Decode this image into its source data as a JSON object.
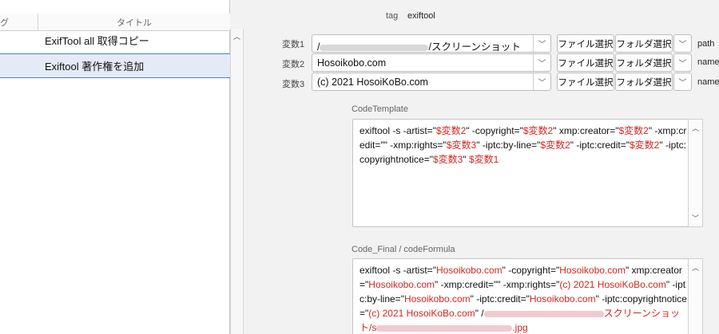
{
  "list": {
    "columns": {
      "tag": "グ",
      "title": "タイトル"
    },
    "rows": [
      {
        "title": "ExifTool all 取得コピー"
      },
      {
        "title": "Exiftool 著作権を追加"
      }
    ]
  },
  "detail": {
    "tag_label": "tag",
    "tag_value": "exiftool",
    "vars": [
      {
        "label": "変数1",
        "value_prefix": "/",
        "value_suffix": "/スクリーンショット",
        "right_label": "path"
      },
      {
        "label": "変数2",
        "value": "Hosoikobo.com",
        "right_label": "name"
      },
      {
        "label": "変数3",
        "value": "(c) 2021 HosoiKoBo.com",
        "right_label": "name"
      }
    ],
    "buttons": {
      "file_select": "ファイル選択",
      "folder_select": "フォルダ選択"
    },
    "code_template": {
      "title": "CodeTemplate",
      "segments": [
        {
          "t": "exiftool -s -artist=\""
        },
        {
          "t": "$変数2",
          "v": true
        },
        {
          "t": "\" -copyright=\""
        },
        {
          "t": "$変数2",
          "v": true
        },
        {
          "t": "\" xmp:creator=\""
        },
        {
          "t": "$変数2",
          "v": true
        },
        {
          "t": "\" -xmp:credit=\"\"  -xmp:rights=\""
        },
        {
          "t": "$変数3",
          "v": true
        },
        {
          "t": "\" -iptc:by-line=\""
        },
        {
          "t": "$変数2",
          "v": true
        },
        {
          "t": "\" -iptc:credit=\""
        },
        {
          "t": "$変数2",
          "v": true
        },
        {
          "t": "\" -iptc:copyrightnotice=\""
        },
        {
          "t": "$変数3",
          "v": true
        },
        {
          "t": "\" "
        },
        {
          "t": "$変数1",
          "v": true
        }
      ]
    },
    "code_final": {
      "title": "Code_Final / codeFormula",
      "segments": [
        {
          "t": "exiftool -s -artist=\""
        },
        {
          "t": "Hosoikobo.com",
          "v": true
        },
        {
          "t": "\" -copyright=\""
        },
        {
          "t": "Hosoikobo.com",
          "v": true
        },
        {
          "t": "\" xmp:creator=\""
        },
        {
          "t": "Hosoikobo.com",
          "v": true
        },
        {
          "t": "\" -xmp:credit=\"\"  -xmp:rights=\""
        },
        {
          "t": "(c) 2021 HosoiKoBo.com",
          "v": true
        },
        {
          "t": "\" -iptc:by-line=\""
        },
        {
          "t": "Hosoikobo.com",
          "v": true
        },
        {
          "t": "\" -iptc:credit=\""
        },
        {
          "t": "Hosoikobo.com",
          "v": true
        },
        {
          "t": "\" -iptc:copyrightnotice=\""
        },
        {
          "t": "(c) 2021 HosoiKoBo.com",
          "v": true
        },
        {
          "t": "\" /"
        },
        {
          "t": "",
          "blur": 150
        },
        {
          "t": "スクリーンショット/s",
          "v": true
        },
        {
          "t": "",
          "blur": 170
        },
        {
          "t": ".jpg",
          "v": true
        }
      ]
    }
  },
  "colors": {
    "accent_selection": "#4a7fd4",
    "variable_text": "#d0261f"
  },
  "icons": [
    "chevron-down-icon",
    "scroll-up-icon",
    "scroll-down-icon"
  ]
}
